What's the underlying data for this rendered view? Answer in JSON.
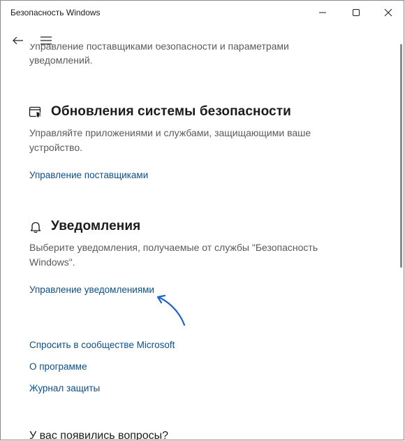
{
  "window": {
    "title": "Безопасность Windows"
  },
  "content": {
    "intro_text": "Управление поставщиками безопасности и параметрами уведомлений.",
    "security_updates": {
      "title": "Обновления системы безопасности",
      "description": "Управляйте приложениями и службами, защищающими ваше устройство.",
      "link": "Управление поставщиками"
    },
    "notifications": {
      "title": "Уведомления",
      "description": "Выберите уведомления, получаемые от службы \"Безопасность Windows\".",
      "link": "Управление уведомлениями"
    },
    "links": [
      "Спросить в сообществе Microsoft",
      "О программе",
      "Журнал защиты"
    ],
    "question": "У вас появились вопросы?"
  },
  "colors": {
    "link": "#0b4f88",
    "annotation_arrow": "#1f63c6"
  }
}
